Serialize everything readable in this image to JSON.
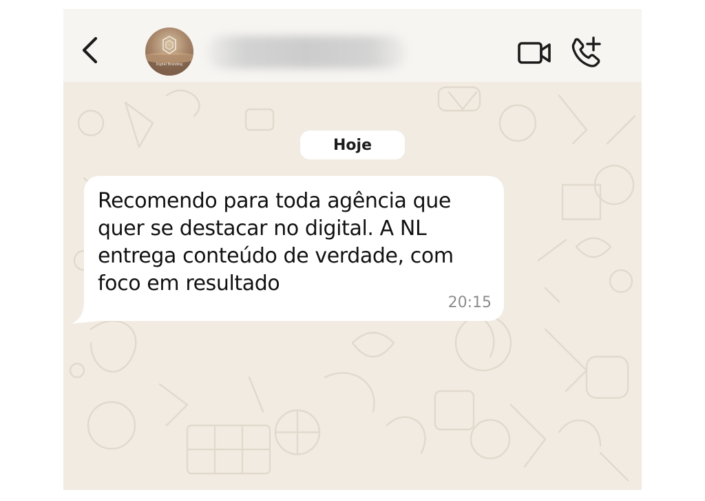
{
  "header": {
    "back_icon": "chevron-left-icon",
    "avatar_caption": "Digital Branding",
    "video_icon": "video-camera-icon",
    "call_icon": "phone-add-icon"
  },
  "chat": {
    "date_separator": "Hoje",
    "message": {
      "text": "Recomendo para toda agência que quer se destacar no digital. A NL entrega conteúdo de verdade, com foco em resultado",
      "time": "20:15"
    }
  },
  "colors": {
    "header_bg": "#f7f5f2",
    "chat_bg": "#f1ebe2",
    "bubble_bg": "#ffffff",
    "icon_color": "#1b1b1b",
    "time_color": "#8c8c8c"
  }
}
